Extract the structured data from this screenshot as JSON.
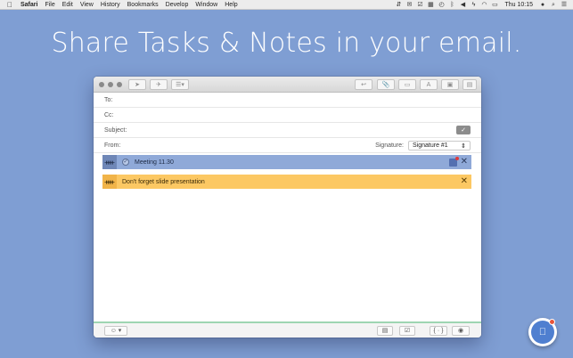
{
  "menubar": {
    "app_name": "Safari",
    "items": [
      "File",
      "Edit",
      "View",
      "History",
      "Bookmarks",
      "Develop",
      "Window",
      "Help"
    ],
    "clock": "Thu 10:15"
  },
  "headline": "Share Tasks & Notes in your email.",
  "compose": {
    "to_label": "To:",
    "cc_label": "Cc:",
    "subject_label": "Subject:",
    "from_label": "From:",
    "signature_label": "Signature:",
    "signature_value": "Signature #1"
  },
  "items": [
    {
      "label": "Meeting 11.30",
      "color": "#8fa9d8"
    },
    {
      "label": "Don't forget slide presentation",
      "color": "#fcc863"
    }
  ],
  "toolbar": {
    "format_label": "A"
  },
  "bottombar": {
    "braces_label": "{ · }"
  },
  "colors": {
    "desktop": "#7f9ed3",
    "accent_line": "#9ed5b2"
  }
}
